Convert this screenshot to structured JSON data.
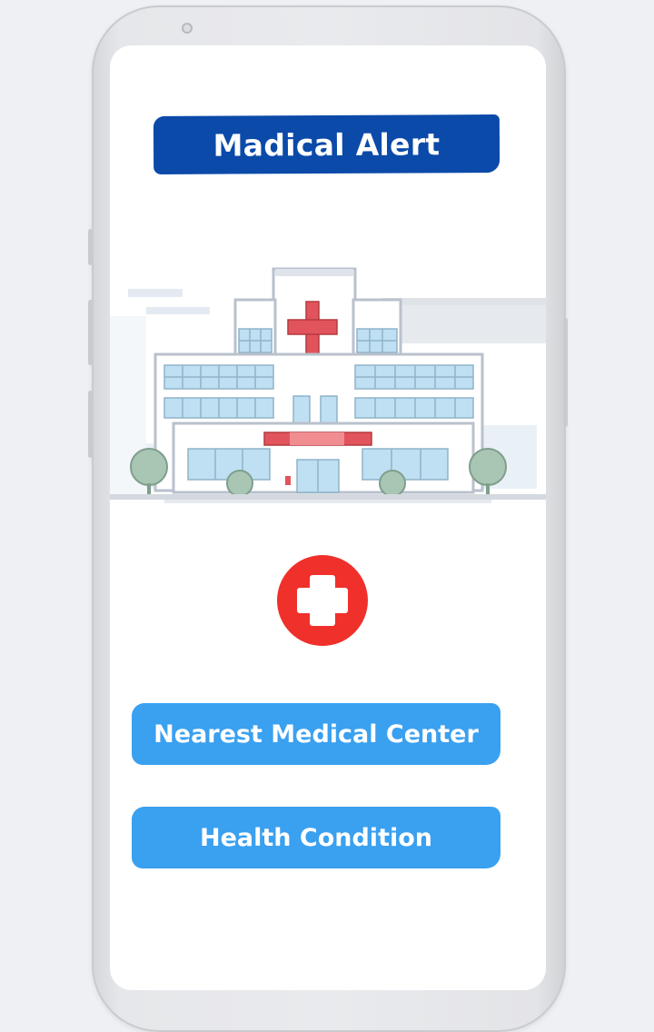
{
  "app": {
    "title": "Madical Alert"
  },
  "hero": {
    "illustration": "hospital-building-illustration",
    "icon": "red-cross-icon"
  },
  "actions": {
    "nearest_medical_center": "Nearest Medical Center",
    "health_condition": "Health Condition"
  },
  "colors": {
    "title_bar": "#0b4aa9",
    "buttons": "#3aa0f0",
    "cross_red": "#f0302a",
    "background": "#ffffff"
  }
}
